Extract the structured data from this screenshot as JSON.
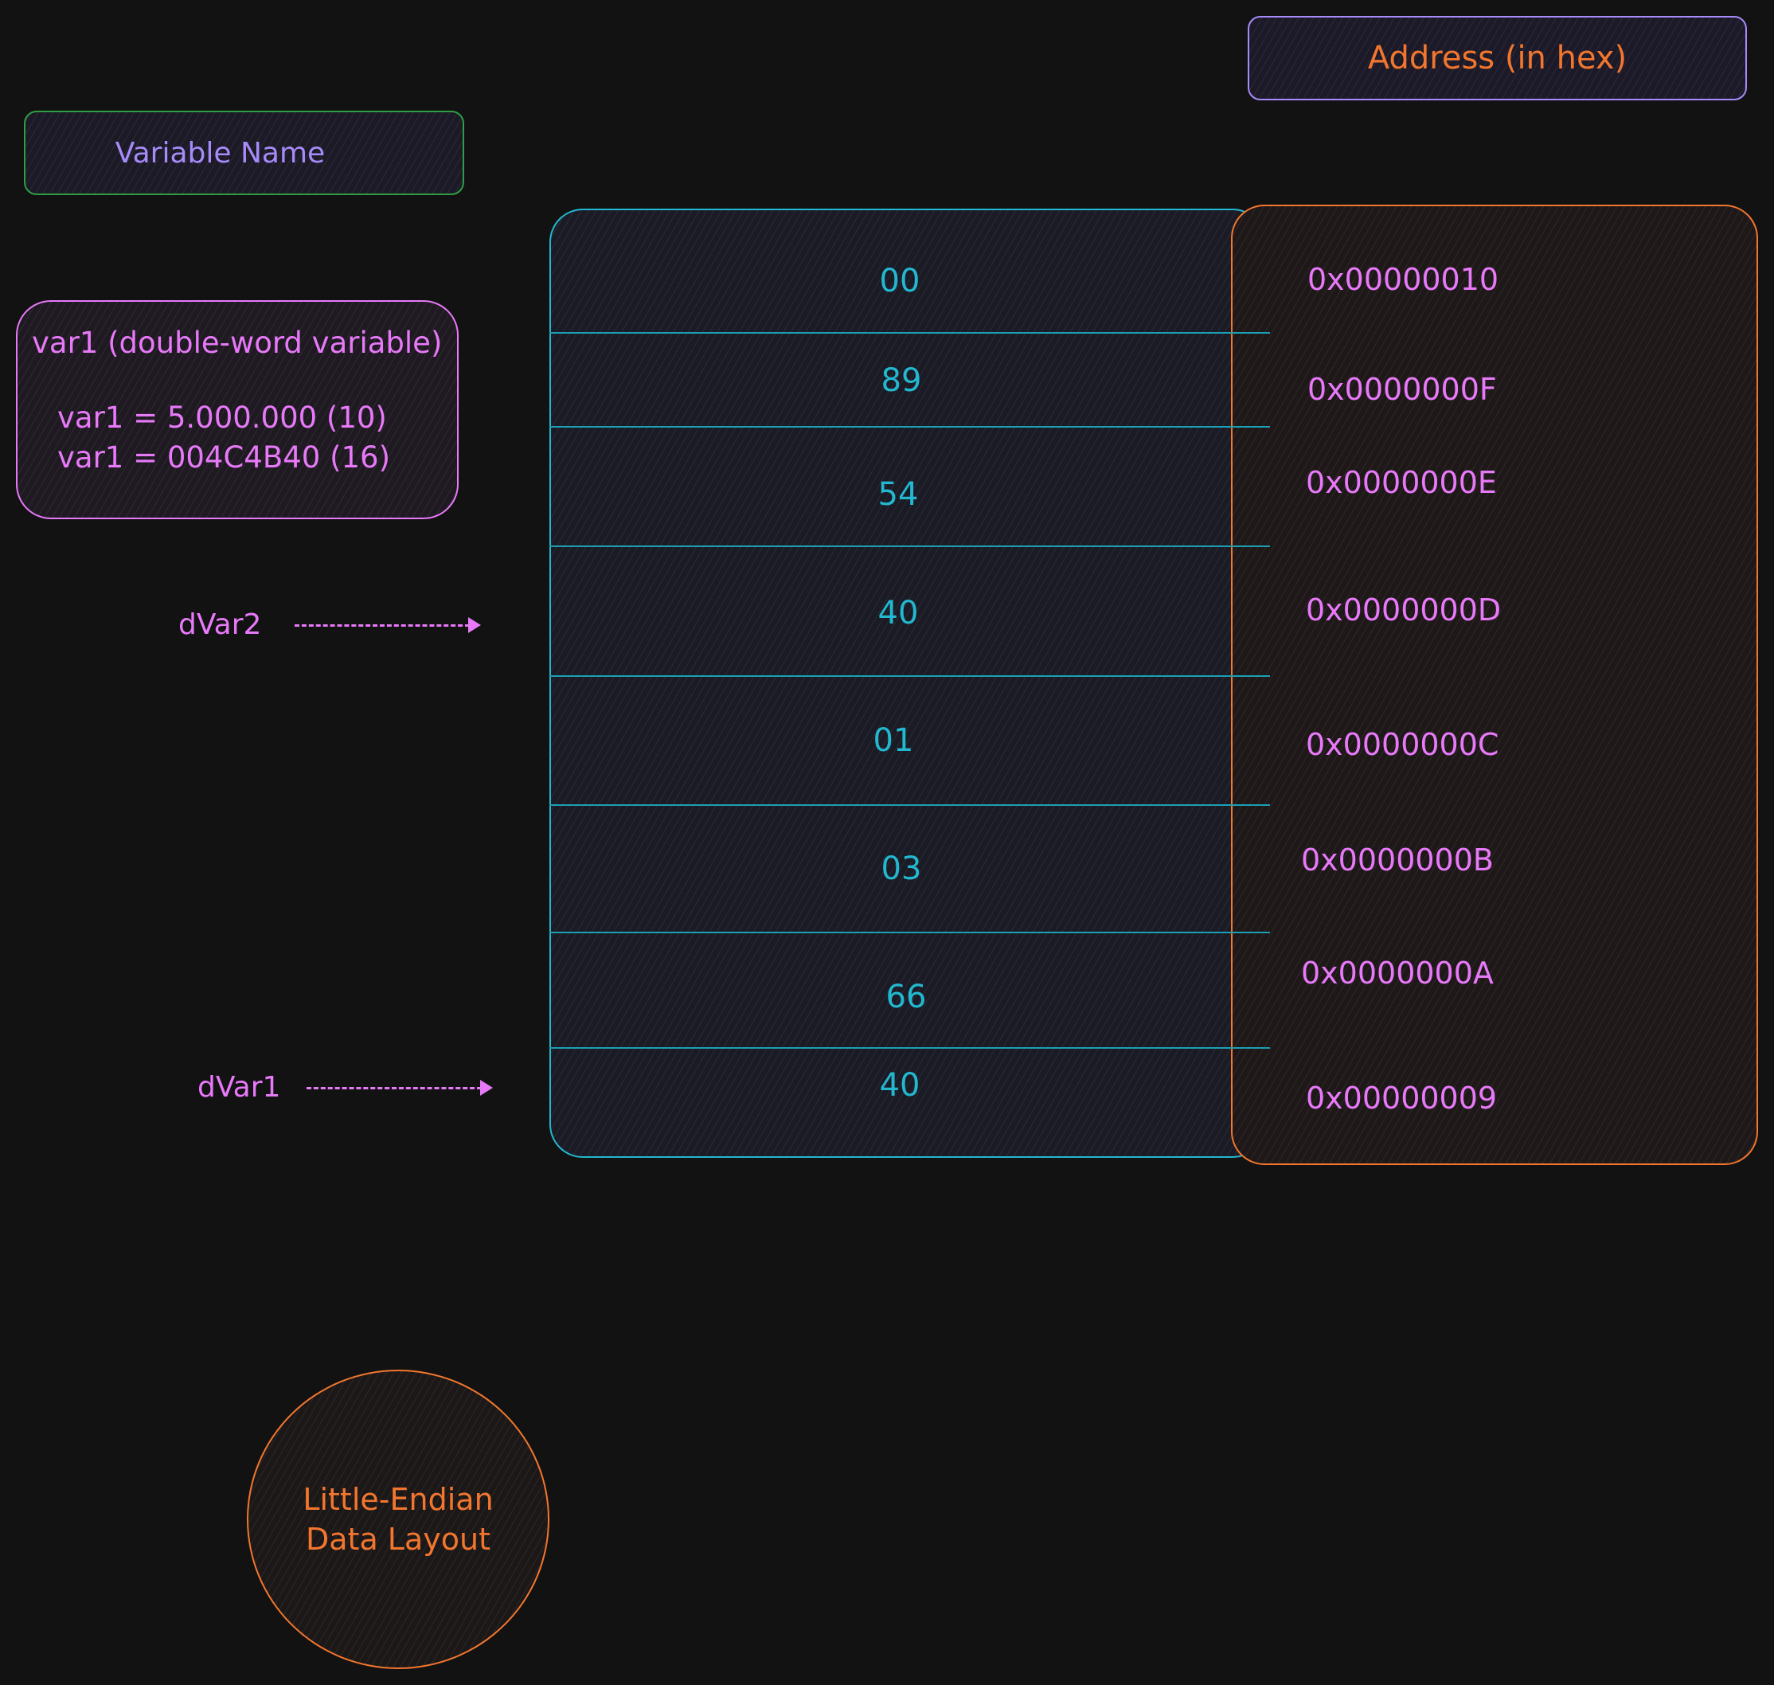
{
  "legend": {
    "address": "Address (in hex)",
    "variable_name": "Variable Name"
  },
  "var1_info": {
    "title": "var1 (double-word variable)",
    "decimal": "var1 = 5.000.000 (10)",
    "hex": "var1 = 004C4B40 (16)"
  },
  "memory": [
    {
      "value": "00",
      "address": "0x00000010"
    },
    {
      "value": "89",
      "address": "0x0000000F"
    },
    {
      "value": "54",
      "address": "0x0000000E"
    },
    {
      "value": "40",
      "address": "0x0000000D"
    },
    {
      "value": "01",
      "address": "0x0000000C"
    },
    {
      "value": "03",
      "address": "0x0000000B"
    },
    {
      "value": "66",
      "address": "0x0000000A"
    },
    {
      "value": "40",
      "address": "0x00000009"
    }
  ],
  "pointers": {
    "dvar2": "dVar2",
    "dvar1": "dVar1"
  },
  "circle": {
    "line1": "Little-Endian",
    "line2": "Data Layout"
  },
  "colors": {
    "background": "#121212",
    "memory_border": "#22b8cf",
    "address_border": "#f2762e",
    "text_pink": "#e879f9",
    "text_purple": "#a78bfa",
    "variable_legend_border": "#2f9e44"
  }
}
